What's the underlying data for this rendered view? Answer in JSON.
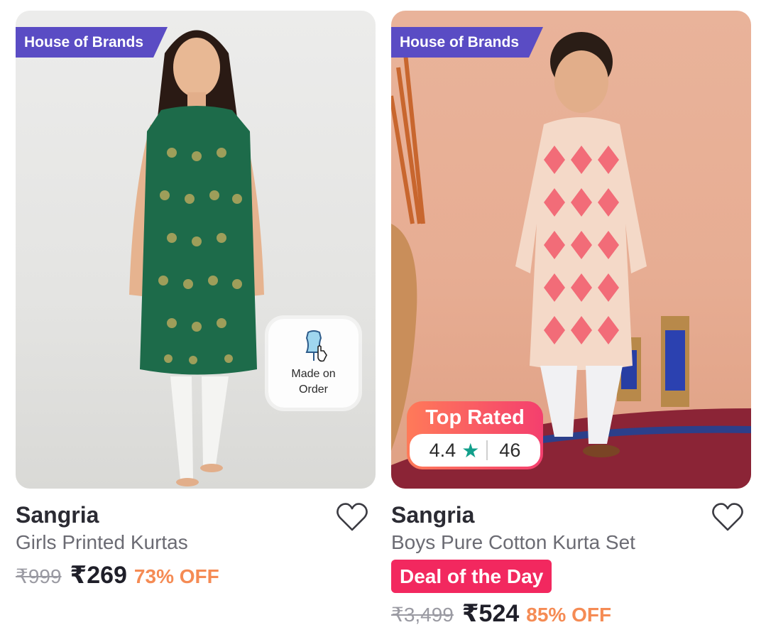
{
  "products": [
    {
      "tag": "House of Brands",
      "brand": "Sangria",
      "name": "Girls Printed Kurtas",
      "mrp": "₹999",
      "price": "₹269",
      "discount": "73% OFF",
      "badge_text": "Made on Order",
      "icons": [
        "mannequin-icon",
        "heart-icon"
      ]
    },
    {
      "tag": "House of Brands",
      "brand": "Sangria",
      "name": "Boys Pure Cotton Kurta Set",
      "deal": "Deal of the Day",
      "mrp": "₹3,499",
      "price": "₹524",
      "discount": "85% OFF",
      "rating_label": "Top Rated",
      "rating": "4.4",
      "rating_count": "46",
      "icons": [
        "star-icon",
        "heart-icon"
      ]
    }
  ],
  "colors": {
    "tag_bg": "#5a4cc4",
    "deal_bg": "#f2285f",
    "discount": "#f58b54",
    "star": "#129f8b"
  }
}
